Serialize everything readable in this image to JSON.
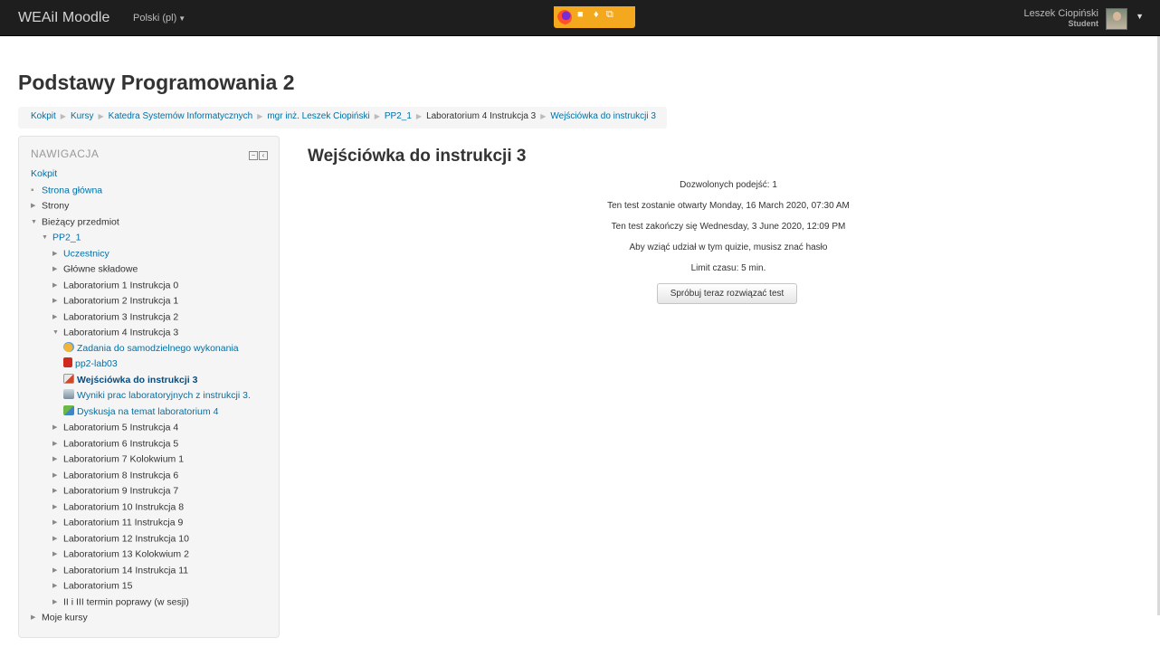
{
  "navbar": {
    "brand": "WEAiI Moodle",
    "language": "Polski (pl)",
    "user_name": "Leszek Ciopiński",
    "user_role": "Student",
    "share_icons": [
      "firefox-icon",
      "camera-icon",
      "microphone-icon",
      "screen-share-icon"
    ]
  },
  "course_title": "Podstawy Programowania 2",
  "breadcrumb": [
    "Kokpit",
    "Kursy",
    "Katedra Systemów Informatycznych",
    "mgr inż. Leszek Ciopiński",
    "PP2_1",
    "Laboratorium 4 Instrukcja 3",
    "Wejściówka do instrukcji 3"
  ],
  "nav": {
    "heading": "NAWIGACJA",
    "kokpit": "Kokpit",
    "strona_glowna": "Strona główna",
    "strony": "Strony",
    "biezacy": "Bieżący przedmiot",
    "course": "PP2_1",
    "uczestnicy": "Uczestnicy",
    "glowne": "Główne składowe",
    "labs_before": [
      "Laboratorium 1 Instrukcja 0",
      "Laboratorium 2 Instrukcja 1",
      "Laboratorium 3 Instrukcja 2"
    ],
    "lab4": "Laboratorium 4 Instrukcja 3",
    "lab4_items": {
      "zadania": "Zadania do samodzielnego wykonania",
      "pdf": "pp2-lab03",
      "quiz": "Wejściówka do instrukcji 3",
      "wyniki": "Wyniki prac laboratoryjnych z instrukcji 3.",
      "dyskusja": "Dyskusja na temat laboratorium 4"
    },
    "labs_after": [
      "Laboratorium 5 Instrukcja 4",
      "Laboratorium 6 Instrukcja 5",
      "Laboratorium 7 Kolokwium 1",
      "Laboratorium 8 Instrukcja 6",
      "Laboratorium 9 Instrukcja 7",
      "Laboratorium 10 Instrukcja 8",
      "Laboratorium 11 Instrukcja 9",
      "Laboratorium 12 Instrukcja 10",
      "Laboratorium 13 Kolokwium 2",
      "Laboratorium 14 Instrukcja 11",
      "Laboratorium 15",
      "II i III termin poprawy (w sesji)"
    ],
    "moje_kursy": "Moje kursy"
  },
  "quiz": {
    "title": "Wejściówka do instrukcji 3",
    "info": [
      "Dozwolonych podejść: 1",
      "Ten test zostanie otwarty Monday, 16 March 2020, 07:30 AM",
      "Ten test zakończy się Wednesday, 3 June 2020, 12:09 PM",
      "Aby wziąć udział w tym quizie, musisz znać hasło",
      "Limit czasu: 5 min."
    ],
    "button": "Spróbuj teraz rozwiązać test"
  },
  "colors": {
    "navbar": "#1e1e1e",
    "link": "#0070a8",
    "share_bar": "#f4a81e"
  }
}
